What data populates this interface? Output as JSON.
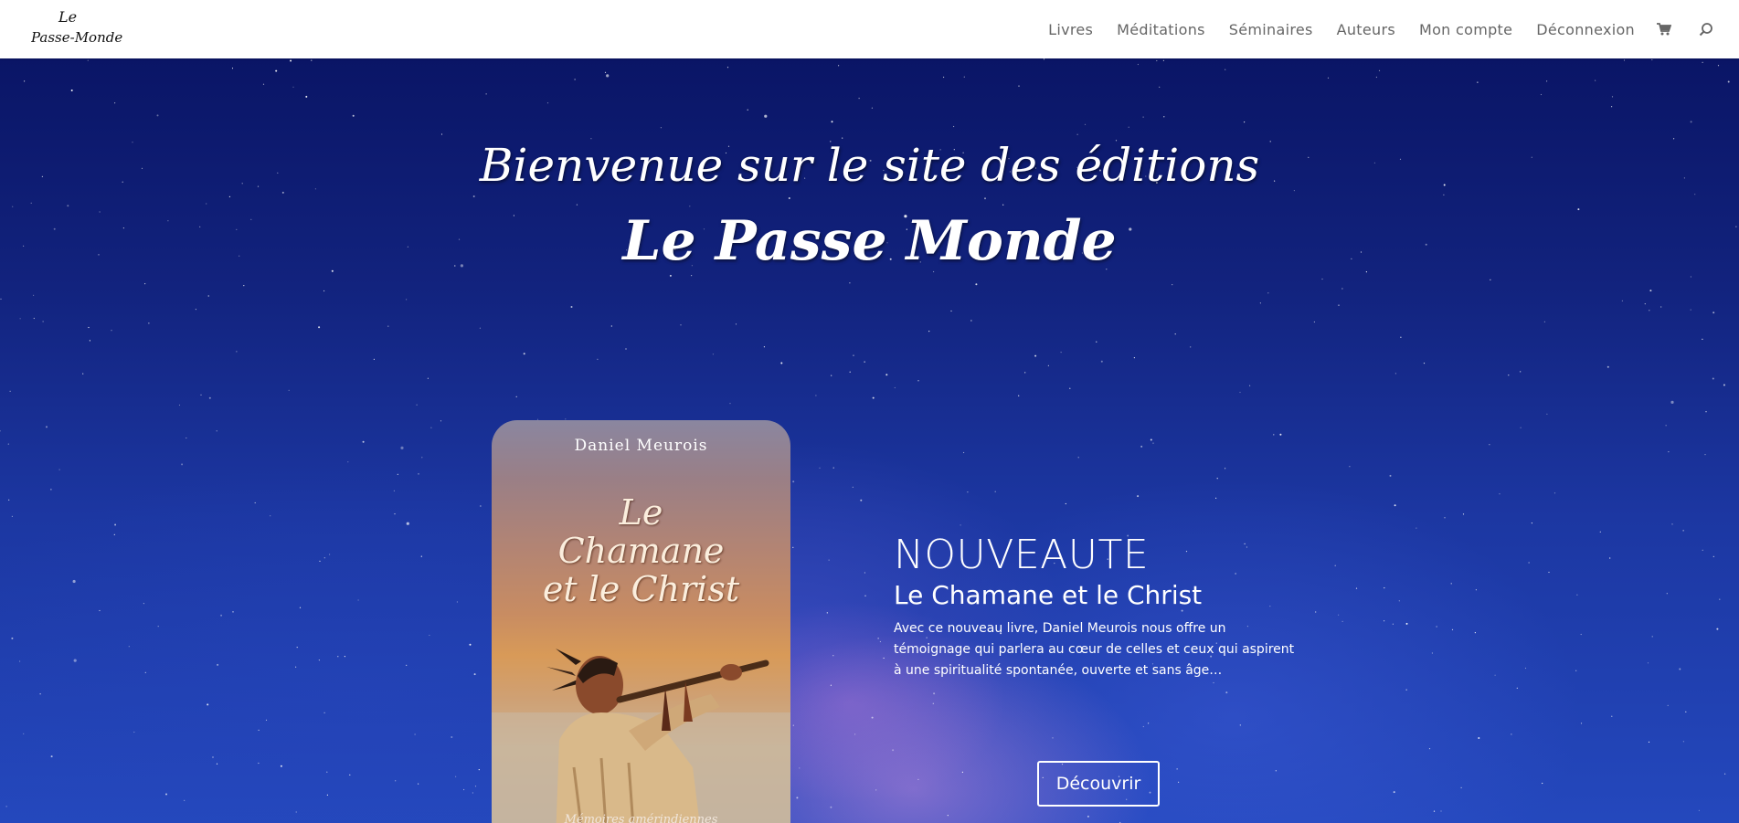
{
  "header": {
    "logo_text_line1": "Le",
    "logo_text_line2": "Passe-Monde",
    "nav": [
      {
        "label": "Livres"
      },
      {
        "label": "Méditations"
      },
      {
        "label": "Séminaires"
      },
      {
        "label": "Auteurs"
      },
      {
        "label": "Mon compte"
      },
      {
        "label": "Déconnexion"
      }
    ],
    "icons": [
      "cart-icon",
      "search-icon"
    ]
  },
  "hero": {
    "welcome": "Bienvenue sur le site des éditions",
    "brand": "Le Passe Monde"
  },
  "book": {
    "author": "Daniel Meurois",
    "title_line1": "Le",
    "title_line2": "Chamane",
    "title_line3": "et le Christ",
    "subtitle": "Mémoires amérindiennes"
  },
  "promo": {
    "tag": "NOUVEAUTE",
    "title": "Le Chamane et le Christ",
    "description": "Avec ce nouveau livre, Daniel Meurois nous offre un témoignage qui parlera au cœur de celles et ceux qui aspirent à une spiritualité spontanée, ouverte et sans âge…",
    "button_label": "Découvrir"
  },
  "colors": {
    "nav_text": "#666666",
    "hero_top": "#0a1566",
    "hero_bottom": "#2448bd"
  }
}
